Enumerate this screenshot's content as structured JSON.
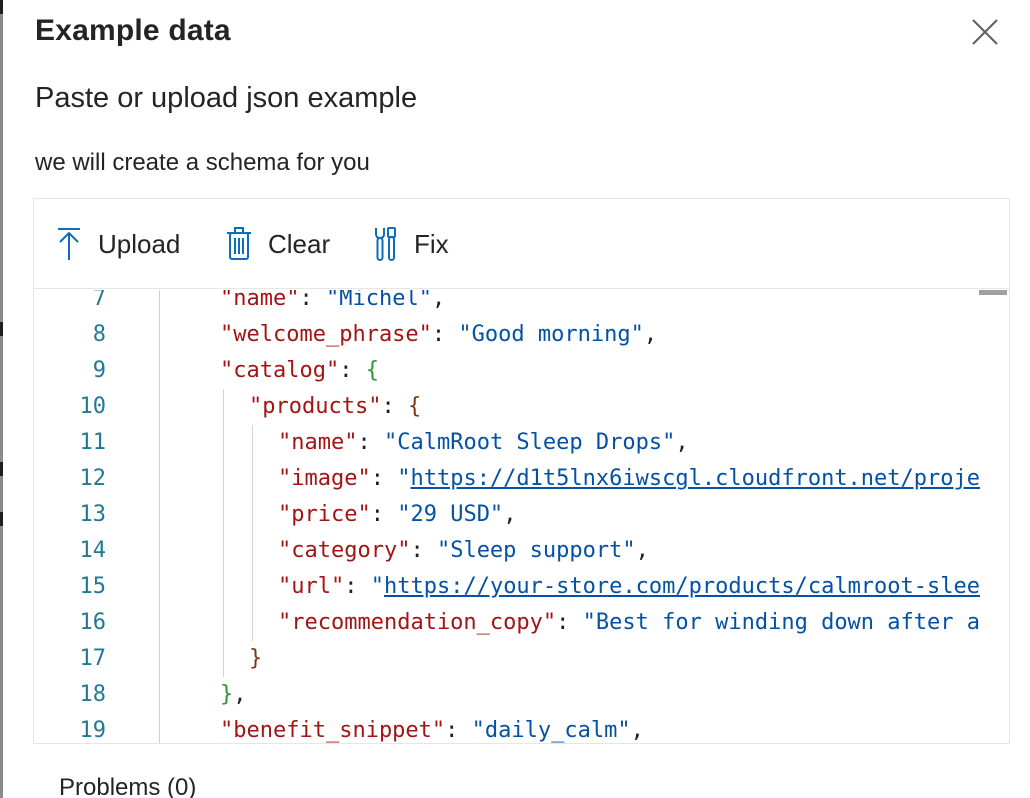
{
  "dialog": {
    "title": "Example data",
    "subtitle": "Paste or upload json example",
    "description": "we will create a schema for you",
    "close_icon": "close-icon"
  },
  "toolbar": {
    "upload_label": "Upload",
    "upload_icon": "upload-arrow-icon",
    "clear_label": "Clear",
    "clear_icon": "trash-icon",
    "fix_label": "Fix",
    "fix_icon": "tools-icon"
  },
  "editor": {
    "lines": [
      {
        "n": "7",
        "indent": 1,
        "tokens": [
          [
            "k",
            "\"name\""
          ],
          [
            "p",
            ": "
          ],
          [
            "s",
            "\"Michel\""
          ],
          [
            "p",
            ","
          ]
        ]
      },
      {
        "n": "8",
        "indent": 1,
        "tokens": [
          [
            "k",
            "\"welcome_phrase\""
          ],
          [
            "p",
            ": "
          ],
          [
            "s",
            "\"Good morning\""
          ],
          [
            "p",
            ","
          ]
        ]
      },
      {
        "n": "9",
        "indent": 1,
        "tokens": [
          [
            "k",
            "\"catalog\""
          ],
          [
            "p",
            ": "
          ],
          [
            "b1",
            "{"
          ]
        ]
      },
      {
        "n": "10",
        "indent": 2,
        "tokens": [
          [
            "k",
            "\"products\""
          ],
          [
            "p",
            ": "
          ],
          [
            "b2",
            "{"
          ]
        ]
      },
      {
        "n": "11",
        "indent": 3,
        "tokens": [
          [
            "k",
            "\"name\""
          ],
          [
            "p",
            ": "
          ],
          [
            "s",
            "\"CalmRoot Sleep Drops\""
          ],
          [
            "p",
            ","
          ]
        ]
      },
      {
        "n": "12",
        "indent": 3,
        "tokens": [
          [
            "k",
            "\"image\""
          ],
          [
            "p",
            ": "
          ],
          [
            "s",
            "\""
          ],
          [
            "u",
            "https://d1t5lnx6iwscgl.cloudfront.net/proje"
          ]
        ]
      },
      {
        "n": "13",
        "indent": 3,
        "tokens": [
          [
            "k",
            "\"price\""
          ],
          [
            "p",
            ": "
          ],
          [
            "s",
            "\"29 USD\""
          ],
          [
            "p",
            ","
          ]
        ]
      },
      {
        "n": "14",
        "indent": 3,
        "tokens": [
          [
            "k",
            "\"category\""
          ],
          [
            "p",
            ": "
          ],
          [
            "s",
            "\"Sleep support\""
          ],
          [
            "p",
            ","
          ]
        ]
      },
      {
        "n": "15",
        "indent": 3,
        "tokens": [
          [
            "k",
            "\"url\""
          ],
          [
            "p",
            ": "
          ],
          [
            "s",
            "\""
          ],
          [
            "u",
            "https://your-store.com/products/calmroot-slee"
          ]
        ]
      },
      {
        "n": "16",
        "indent": 3,
        "tokens": [
          [
            "k",
            "\"recommendation_copy\""
          ],
          [
            "p",
            ": "
          ],
          [
            "s",
            "\"Best for winding down after a"
          ]
        ]
      },
      {
        "n": "17",
        "indent": 2,
        "tokens": [
          [
            "b2",
            "}"
          ]
        ]
      },
      {
        "n": "18",
        "indent": 1,
        "tokens": [
          [
            "b1",
            "}"
          ],
          [
            "p",
            ","
          ]
        ]
      },
      {
        "n": "19",
        "indent": 1,
        "tokens": [
          [
            "k",
            "\"benefit_snippet\""
          ],
          [
            "p",
            ": "
          ],
          [
            "s",
            "\"daily_calm\""
          ],
          [
            "p",
            ","
          ]
        ]
      }
    ]
  },
  "problems": {
    "label": "Problems (0)"
  }
}
